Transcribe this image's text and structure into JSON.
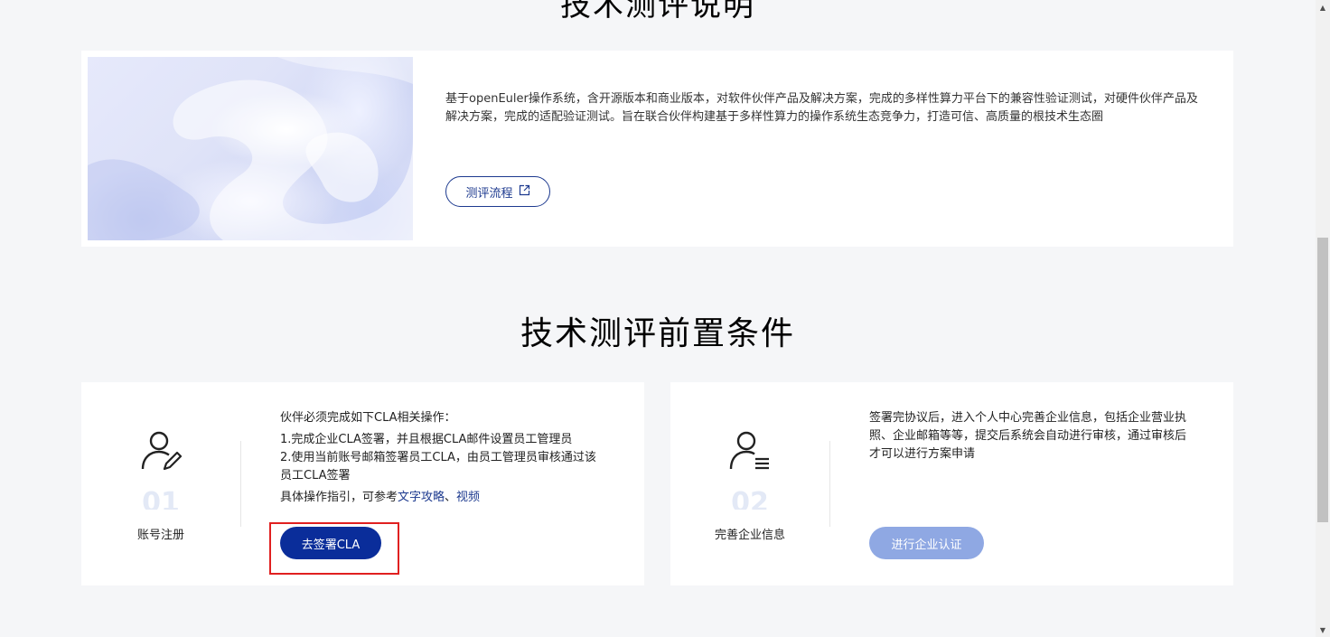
{
  "top_heading": "技术测评说明",
  "intro": {
    "description": "基于openEuler操作系统，含开源版本和商业版本，对软件伙伴产品及解决方案，完成的多样性算力平台下的兼容性验证测试，对硬件伙伴产品及解决方案，完成的适配验证测试。旨在联合伙伴构建基于多样性算力的操作系统生态竞争力，打造可信、高质量的根技术生态圈",
    "button_label": "测评流程",
    "button_icon": "external-link-icon"
  },
  "section_heading": "技术测评前置条件",
  "steps": [
    {
      "number": "01",
      "title": "账号注册",
      "icon": "user-edit-icon",
      "intro": "伙伴必须完成如下CLA相关操作：",
      "line1": "1.完成企业CLA签署，并且根据CLA邮件设置员工管理员",
      "line2": "2.使用当前账号邮箱签署员工CLA，由员工管理员审核通过该员工CLA签署",
      "guide_prefix": "具体操作指引，可参考",
      "guide_link1": "文字攻略",
      "guide_sep": "、",
      "guide_link2": "视频",
      "button_label": "去签署CLA"
    },
    {
      "number": "02",
      "title": "完善企业信息",
      "icon": "user-list-icon",
      "description": "签署完协议后，进入个人中心完善企业信息，包括企业营业执照、企业邮箱等等，提交后系统会自动进行审核，通过审核后才可以进行方案申请",
      "button_label": "进行企业认证"
    }
  ],
  "colors": {
    "primary": "#0a2d9a",
    "disabled": "#8fa8e3",
    "highlight": "#e02020",
    "background": "#f5f6f8"
  },
  "scrollbar": {
    "up_glyph": "▲",
    "down_glyph": "▼"
  }
}
